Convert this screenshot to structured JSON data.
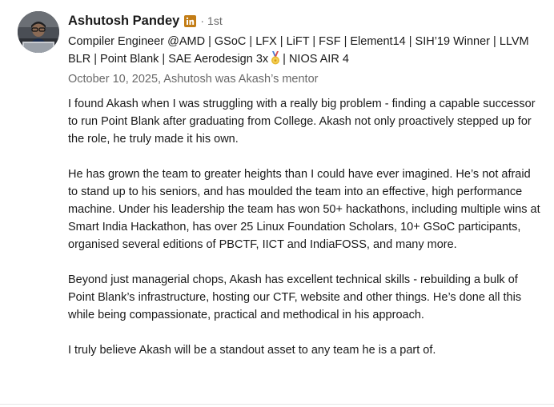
{
  "recommender": {
    "name": "Ashutosh Pandey",
    "badge_icon": "linkedin-premium-icon",
    "badge_color": "#c37d16",
    "separator": "·",
    "connection_degree": "1st",
    "headline_part1": "Compiler Engineer @AMD | GSoC | LFX | LiFT | FSF | Element14 | SIH’19 Winner | LLVM BLR | Point Blank | SAE Aerodesign 3x",
    "headline_icon": "medal-icon",
    "headline_part2": "| NIOS AIR 4",
    "relationship": "October 10, 2025, Ashutosh was Akash’s mentor"
  },
  "recommendation": {
    "paragraphs": [
      "I found Akash when I was struggling with a really big problem - finding a capable successor to run Point Blank after graduating from College. Akash not only proactively stepped up for the role, he truly made it his own.",
      "He has grown the team to greater heights than I could have ever imagined. He’s not afraid to stand up to his seniors, and has moulded the team into an effective, high performance machine. Under his leadership the team has won 50+ hackathons, including multiple wins at Smart India Hackathon, has over 25 Linux Foundation Scholars, 10+ GSoC participants, organised several editions of PBCTF, IICT and IndiaFOSS, and many more.",
      "Beyond just managerial chops, Akash has excellent technical skills - rebuilding a bulk of Point Blank’s infrastructure, hosting our CTF, website and other things. He’s done all this while being compassionate, practical and methodical in his approach.",
      "I truly believe Akash will be a standout asset to any team he is a part of."
    ]
  }
}
